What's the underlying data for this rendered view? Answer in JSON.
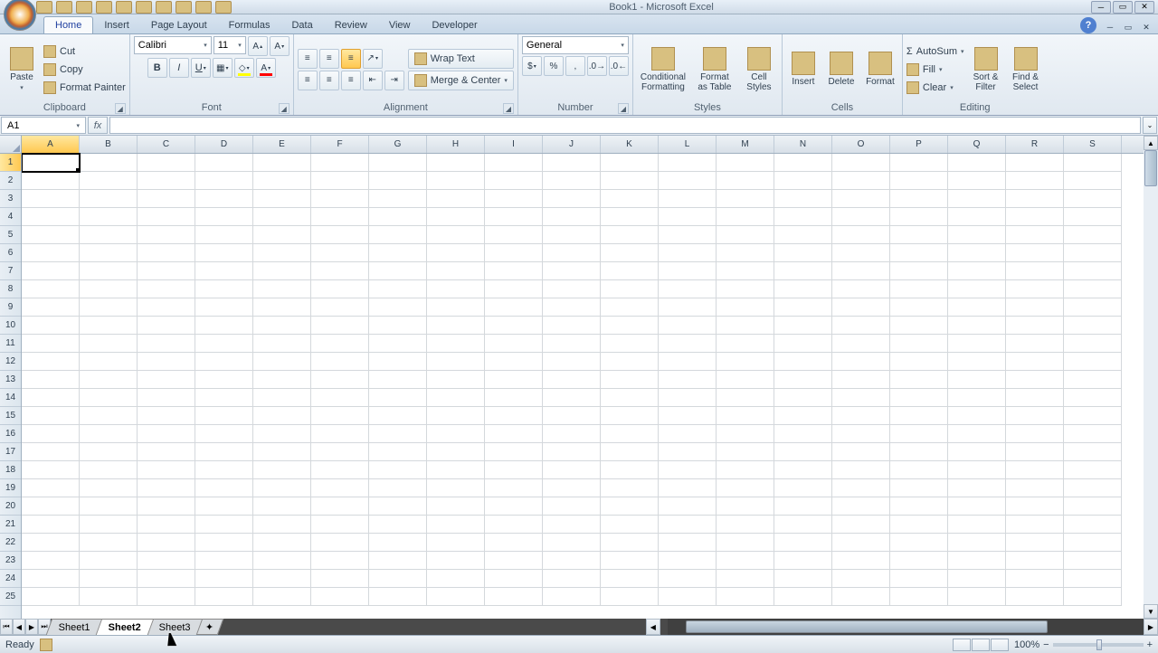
{
  "titlebar": {
    "title": "Book1 - Microsoft Excel"
  },
  "tabs": [
    "Home",
    "Insert",
    "Page Layout",
    "Formulas",
    "Data",
    "Review",
    "View",
    "Developer"
  ],
  "active_tab": 0,
  "clipboard": {
    "paste": "Paste",
    "cut": "Cut",
    "copy": "Copy",
    "fp": "Format Painter",
    "label": "Clipboard"
  },
  "font": {
    "name": "Calibri",
    "size": "11",
    "label": "Font"
  },
  "alignment": {
    "wrap": "Wrap Text",
    "merge": "Merge & Center",
    "label": "Alignment"
  },
  "number": {
    "format": "General",
    "label": "Number"
  },
  "styles": {
    "cf": "Conditional\nFormatting",
    "fat": "Format\nas Table",
    "cs": "Cell\nStyles",
    "label": "Styles"
  },
  "cells": {
    "insert": "Insert",
    "delete": "Delete",
    "format": "Format",
    "label": "Cells"
  },
  "editing": {
    "autosum": "AutoSum",
    "fill": "Fill",
    "clear": "Clear",
    "sort": "Sort &\nFilter",
    "find": "Find &\nSelect",
    "label": "Editing"
  },
  "namebox": "A1",
  "columns": [
    "A",
    "B",
    "C",
    "D",
    "E",
    "F",
    "G",
    "H",
    "I",
    "J",
    "K",
    "L",
    "M",
    "N",
    "O",
    "P",
    "Q",
    "R",
    "S"
  ],
  "rows": [
    1,
    2,
    3,
    4,
    5,
    6,
    7,
    8,
    9,
    10,
    11,
    12,
    13,
    14,
    15,
    16,
    17,
    18,
    19,
    20,
    21,
    22,
    23,
    24,
    25
  ],
  "sheets": [
    "Sheet1",
    "Sheet2",
    "Sheet3"
  ],
  "active_sheet": 1,
  "status": "Ready",
  "zoom": "100%"
}
